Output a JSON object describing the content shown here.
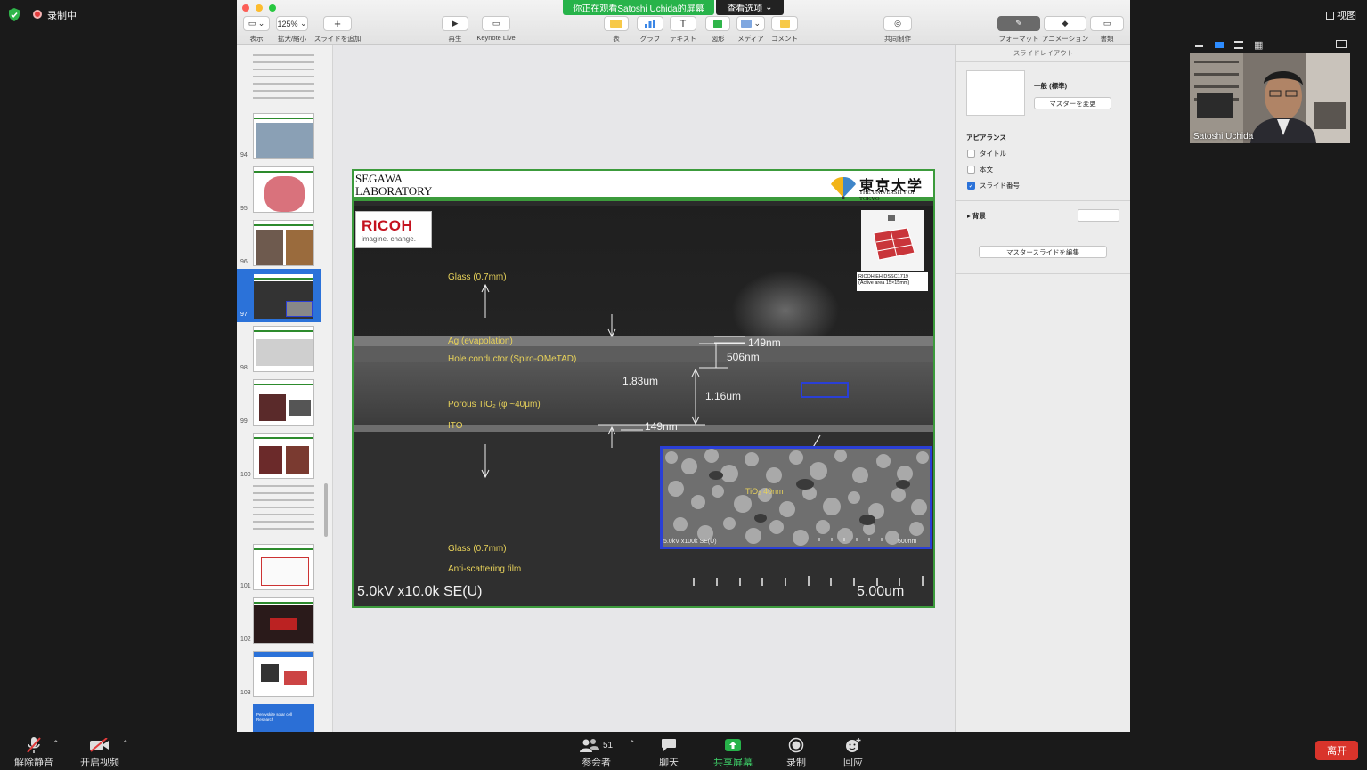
{
  "zoom": {
    "recording_label": "录制中",
    "view_label": "视图",
    "banner_text": "你正在观看Satoshi  Uchida的屏幕",
    "view_options_label": "查看选项",
    "participant_count": "51",
    "participant_name": "Satoshi Uchida",
    "bottom": {
      "unmute": "解除静音",
      "start_video": "开启视频",
      "participants": "参会者",
      "chat": "聊天",
      "share_screen": "共享屏幕",
      "record": "录制",
      "reactions": "回应",
      "leave": "离开"
    }
  },
  "keynote": {
    "toolbar": {
      "view_label": "表示",
      "zoom_value": "125%",
      "zoom_label": "拡大/縮小",
      "add_slide_label": "スライドを追加",
      "play_label": "再生",
      "keynote_live_label": "Keynote Live",
      "table_label": "表",
      "chart_label": "グラフ",
      "text_label": "テキスト",
      "shape_label": "図形",
      "media_label": "メディア",
      "comment_label": "コメント",
      "collab_label": "共同制作",
      "format_label": "フォーマット",
      "animate_label": "アニメーション",
      "document_label": "書類"
    },
    "navigator": {
      "slide_numbers": [
        "94",
        "95",
        "96",
        "97",
        "98",
        "99",
        "100",
        "101",
        "102",
        "103"
      ],
      "last_thumb_text": "Perovskite solar cell Research"
    },
    "inspector": {
      "title": "スライドレイアウト",
      "layout_name": "一般 (標準)",
      "change_master": "マスターを変更",
      "appearance": "アピアランス",
      "title_option": "タイトル",
      "body_option": "本文",
      "slide_number_option": "スライド番号",
      "background": "背景",
      "edit_master": "マスタースライドを編集"
    },
    "slide": {
      "lab_line1": "SEGAWA",
      "lab_line2": "LABORATORY",
      "univ_jp": "東京大学",
      "univ_en": "THE UNIVERSITY OF TOKYO",
      "ricoh_name": "RICOH",
      "ricoh_tag": "imagine. change.",
      "module_caption1": "RICOH EH DSSC1719",
      "module_caption2": "(Active area 15×15mm)",
      "layers": {
        "glass_top": "Glass (0.7mm)",
        "ag": "Ag (evapolation)",
        "hole": "Hole conductor (Spiro-OMeTAD)",
        "porous": "Porous TiO₂ (φ ~40μm)",
        "ito": "ITO",
        "glass_bottom": "Glass (0.7mm)",
        "anti": "Anti-scattering film"
      },
      "measures": {
        "m149_top": "149nm",
        "m506": "506nm",
        "m183": "1.83um",
        "m116": "1.16um",
        "m149_bottom": "149nm"
      },
      "inset_tio": "TiO₂ 40nm",
      "inset_info": "5.0kV x100k SE(U)",
      "inset_scale": "500nm",
      "sem_info": "5.0kV x10.0k SE(U)",
      "sem_scale": "5.00um"
    }
  }
}
